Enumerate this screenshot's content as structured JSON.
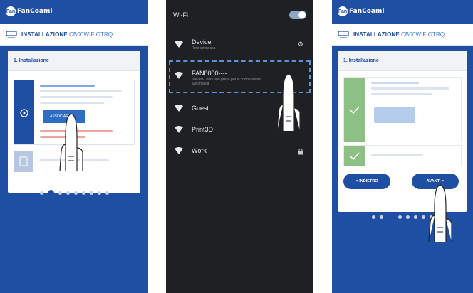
{
  "app": {
    "brand": "FanCoami",
    "brand_badge": "Fan",
    "model_icon": "fan-icon",
    "title_prefix": "INSTALLAZIONE",
    "title_model": "CB00WIFIOTRQ",
    "step_title": "1. Installazione"
  },
  "screen1": {
    "button_label": "ASSOCIARE",
    "pagination": {
      "total": 9,
      "active": 1
    }
  },
  "screen2": {
    "header_label": "Wi-Fi",
    "toggle_on": true,
    "networks": [
      {
        "name": "Device",
        "sub": "Rete connessa",
        "right_icon": "gear-icon",
        "right_glyph": "⚙"
      },
      {
        "name": "FAN8000----",
        "sub": "Salvata. Tieni una presa per la connessione automatica",
        "right_icon": "",
        "right_glyph": ""
      },
      {
        "name": "Guest",
        "sub": "",
        "right_icon": "",
        "right_glyph": ""
      },
      {
        "name": "Print3D",
        "sub": "",
        "right_icon": "",
        "right_glyph": ""
      },
      {
        "name": "Work",
        "sub": "",
        "right_icon": "lock-icon",
        "right_glyph": "🔒"
      }
    ]
  },
  "screen3": {
    "back_button": "< INDIETRO",
    "next_button": "AVANTI >",
    "pagination": {
      "total": 8,
      "active": 2
    }
  },
  "colors": {
    "app_blue": "#1f4fa3",
    "success_green": "#8cc084",
    "dark_bg": "#1e2024",
    "selection_border": "#5b94d6"
  }
}
